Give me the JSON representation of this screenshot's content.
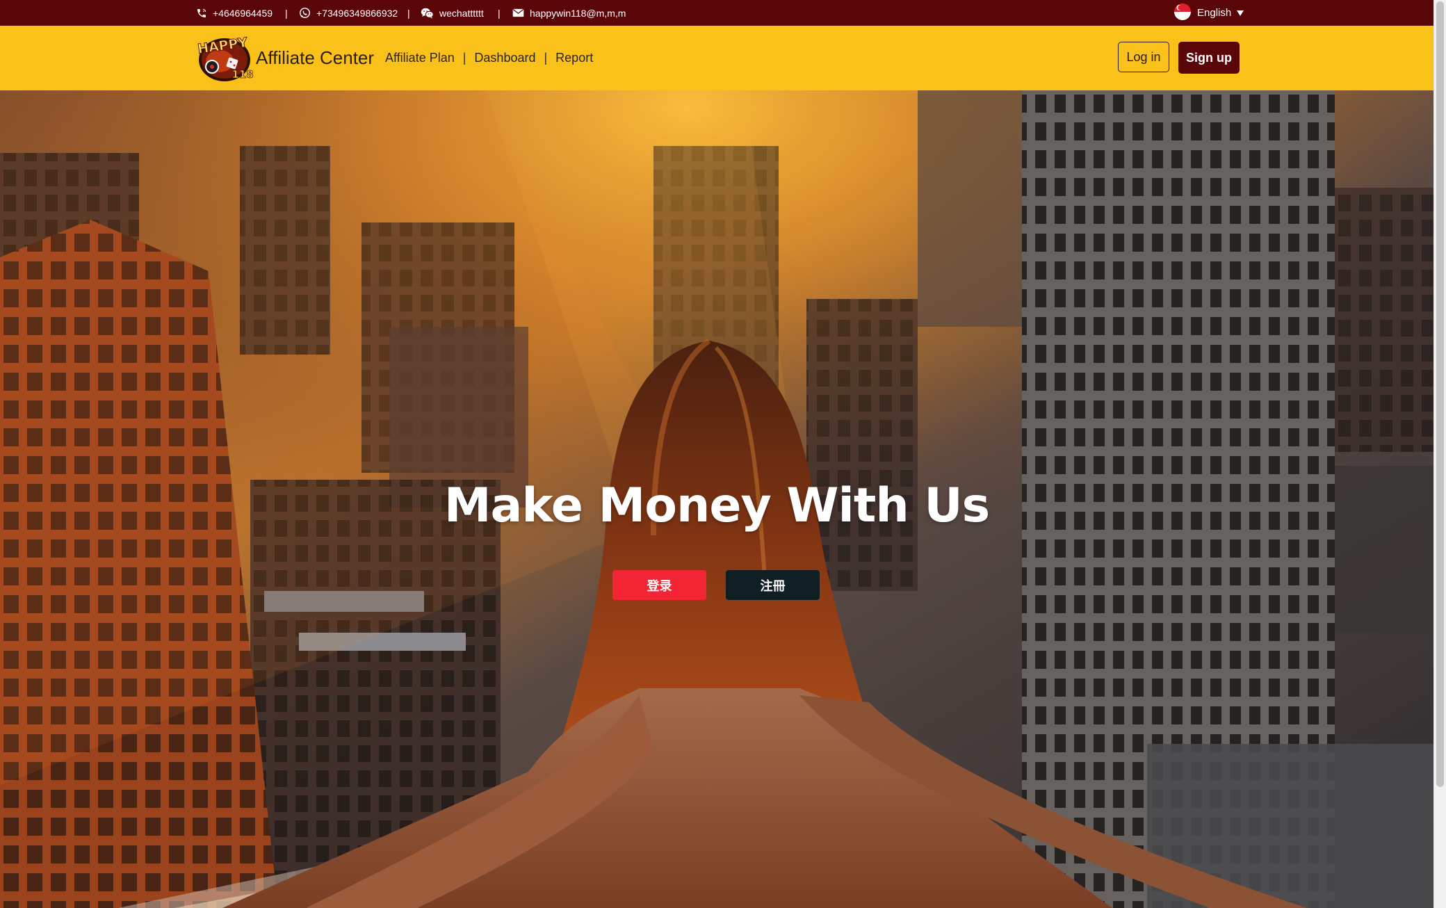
{
  "topbar": {
    "phone": "+4646964459",
    "whatsapp": "+73496349866932",
    "wechat": "wechatttttt",
    "email": "happywin118@m,m,m",
    "separator": "|",
    "language": "English"
  },
  "header": {
    "logo_text_top": "HAPPY",
    "logo_text_bottom": "118",
    "brand": "Affiliate Center",
    "nav": [
      "Affiliate Plan",
      "Dashboard",
      "Report"
    ],
    "nav_separator": "|",
    "login_label": "Log in",
    "signup_label": "Sign up"
  },
  "hero": {
    "title": "Make Money With Us",
    "login_button": "登录",
    "register_button": "注冊"
  },
  "icons": {
    "phone": "phone-icon",
    "whatsapp": "whatsapp-icon",
    "wechat": "wechat-icon",
    "email": "email-icon",
    "flag": "singapore-flag-icon",
    "caret": "caret-down-icon"
  },
  "colors": {
    "topbar": "#5a0508",
    "header": "#fbc11b",
    "signup": "#5a0508",
    "hero_login": "#f22535",
    "hero_register": "#0f1e22"
  }
}
